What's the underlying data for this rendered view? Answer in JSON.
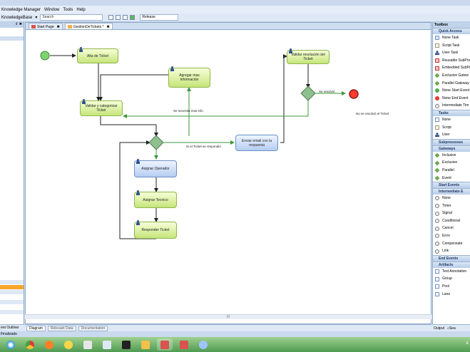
{
  "menu": [
    "Knowledge Manager",
    "Window",
    "Tools",
    "Help"
  ],
  "toolbar": {
    "kb_label": "KnowledgeBase",
    "search_placeholder": "Search",
    "release": "Release"
  },
  "left_panel": {
    "outline_label": "Knowledge Base Navigator / Document Outline",
    "outline_short": "ent Outliner"
  },
  "tabs": [
    {
      "label": "Start Page",
      "close": "✖"
    },
    {
      "label": "GestionDeTickets *",
      "close": "✖"
    }
  ],
  "diagram": {
    "tasks": {
      "alta": "Alta de Ticket",
      "agregar": "Agregar mas información",
      "validar_cat": "Validar y categorizar Ticket",
      "validar_res": "Validar resolución del Ticket",
      "enviar": "Enviar email con la respuesta",
      "asignar_op": "Asignar Operador",
      "asignar_tec": "Asignar Tecnico",
      "responder": "Responder Ticket"
    },
    "labels": {
      "se_necesita": "Se necesita mas info",
      "se_resolvio": "Se resolvió",
      "no_resolvio": "No se resolvió el Ticket",
      "si_ticket": "Si el Ticket se respondió"
    }
  },
  "bottom_tabs": [
    {
      "label": "Diagram",
      "active": true
    },
    {
      "label": "Relevant Data",
      "active": false
    },
    {
      "label": "Documentation",
      "active": false
    }
  ],
  "scrollbar_label": "III",
  "toolbox": {
    "title": "Toolbox",
    "sections": [
      {
        "name": "Quick Access",
        "items": [
          {
            "label": "None Task",
            "icon": "task"
          },
          {
            "label": "Script Task",
            "icon": "script"
          },
          {
            "label": "User Task",
            "icon": "user"
          },
          {
            "label": "Reusable SubPro",
            "icon": "red"
          },
          {
            "label": "Embedded SubPr",
            "icon": "red"
          },
          {
            "label": "Exclusive Gatew",
            "icon": "gw"
          },
          {
            "label": "Parallel Gateway",
            "icon": "gw"
          },
          {
            "label": "None Start Event",
            "icon": "start"
          },
          {
            "label": "None End Event",
            "icon": "end"
          },
          {
            "label": "Intermediate Tim",
            "icon": "inter"
          }
        ]
      },
      {
        "name": "Tasks",
        "items": [
          {
            "label": "None",
            "icon": "none"
          },
          {
            "label": "Script",
            "icon": "script"
          },
          {
            "label": "User",
            "icon": "user"
          }
        ]
      },
      {
        "name": "Subprocesses",
        "items": []
      },
      {
        "name": "Gateways",
        "items": [
          {
            "label": "Inclusive",
            "icon": "gw"
          },
          {
            "label": "Exclusive",
            "icon": "gw"
          },
          {
            "label": "Parallel",
            "icon": "gw"
          },
          {
            "label": "Event",
            "icon": "gw"
          }
        ]
      },
      {
        "name": "Start Events",
        "items": []
      },
      {
        "name": "Intermediate E",
        "items": [
          {
            "label": "None",
            "icon": "inter"
          },
          {
            "label": "Timer",
            "icon": "inter"
          },
          {
            "label": "Signal",
            "icon": "inter"
          },
          {
            "label": "Conditional",
            "icon": "inter"
          },
          {
            "label": "Cancel",
            "icon": "inter"
          },
          {
            "label": "Error",
            "icon": "inter"
          },
          {
            "label": "Compensate",
            "icon": "inter"
          },
          {
            "label": "Link",
            "icon": "inter"
          }
        ]
      },
      {
        "name": "End Events",
        "items": []
      },
      {
        "name": "Artifacts",
        "items": [
          {
            "label": "Text Annotation",
            "icon": "none"
          },
          {
            "label": "Group",
            "icon": "none"
          },
          {
            "label": "Pool",
            "icon": "none"
          },
          {
            "label": "Lane",
            "icon": "none"
          }
        ]
      }
    ],
    "bottom": [
      "Output",
      "Sea"
    ]
  },
  "status": "Finalizado",
  "clock": "E"
}
